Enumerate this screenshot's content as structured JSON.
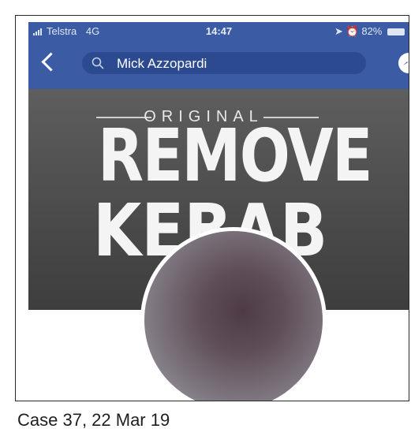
{
  "status_bar": {
    "carrier": "Telstra",
    "network": "4G",
    "time": "14:47",
    "battery": "82%"
  },
  "header": {
    "search_text": "Mick Azzopardi"
  },
  "cover": {
    "line1": "ORIGINAL",
    "line2": "REMOVE",
    "line3": "KEBAB"
  },
  "icons": {
    "back": "chevron-left-icon",
    "search": "search-icon",
    "messenger": "messenger-icon"
  },
  "colors": {
    "header_bg": "#3b5ba5",
    "search_bg": "#2c4a8f"
  },
  "caption": "Case 37, 22 Mar 19"
}
